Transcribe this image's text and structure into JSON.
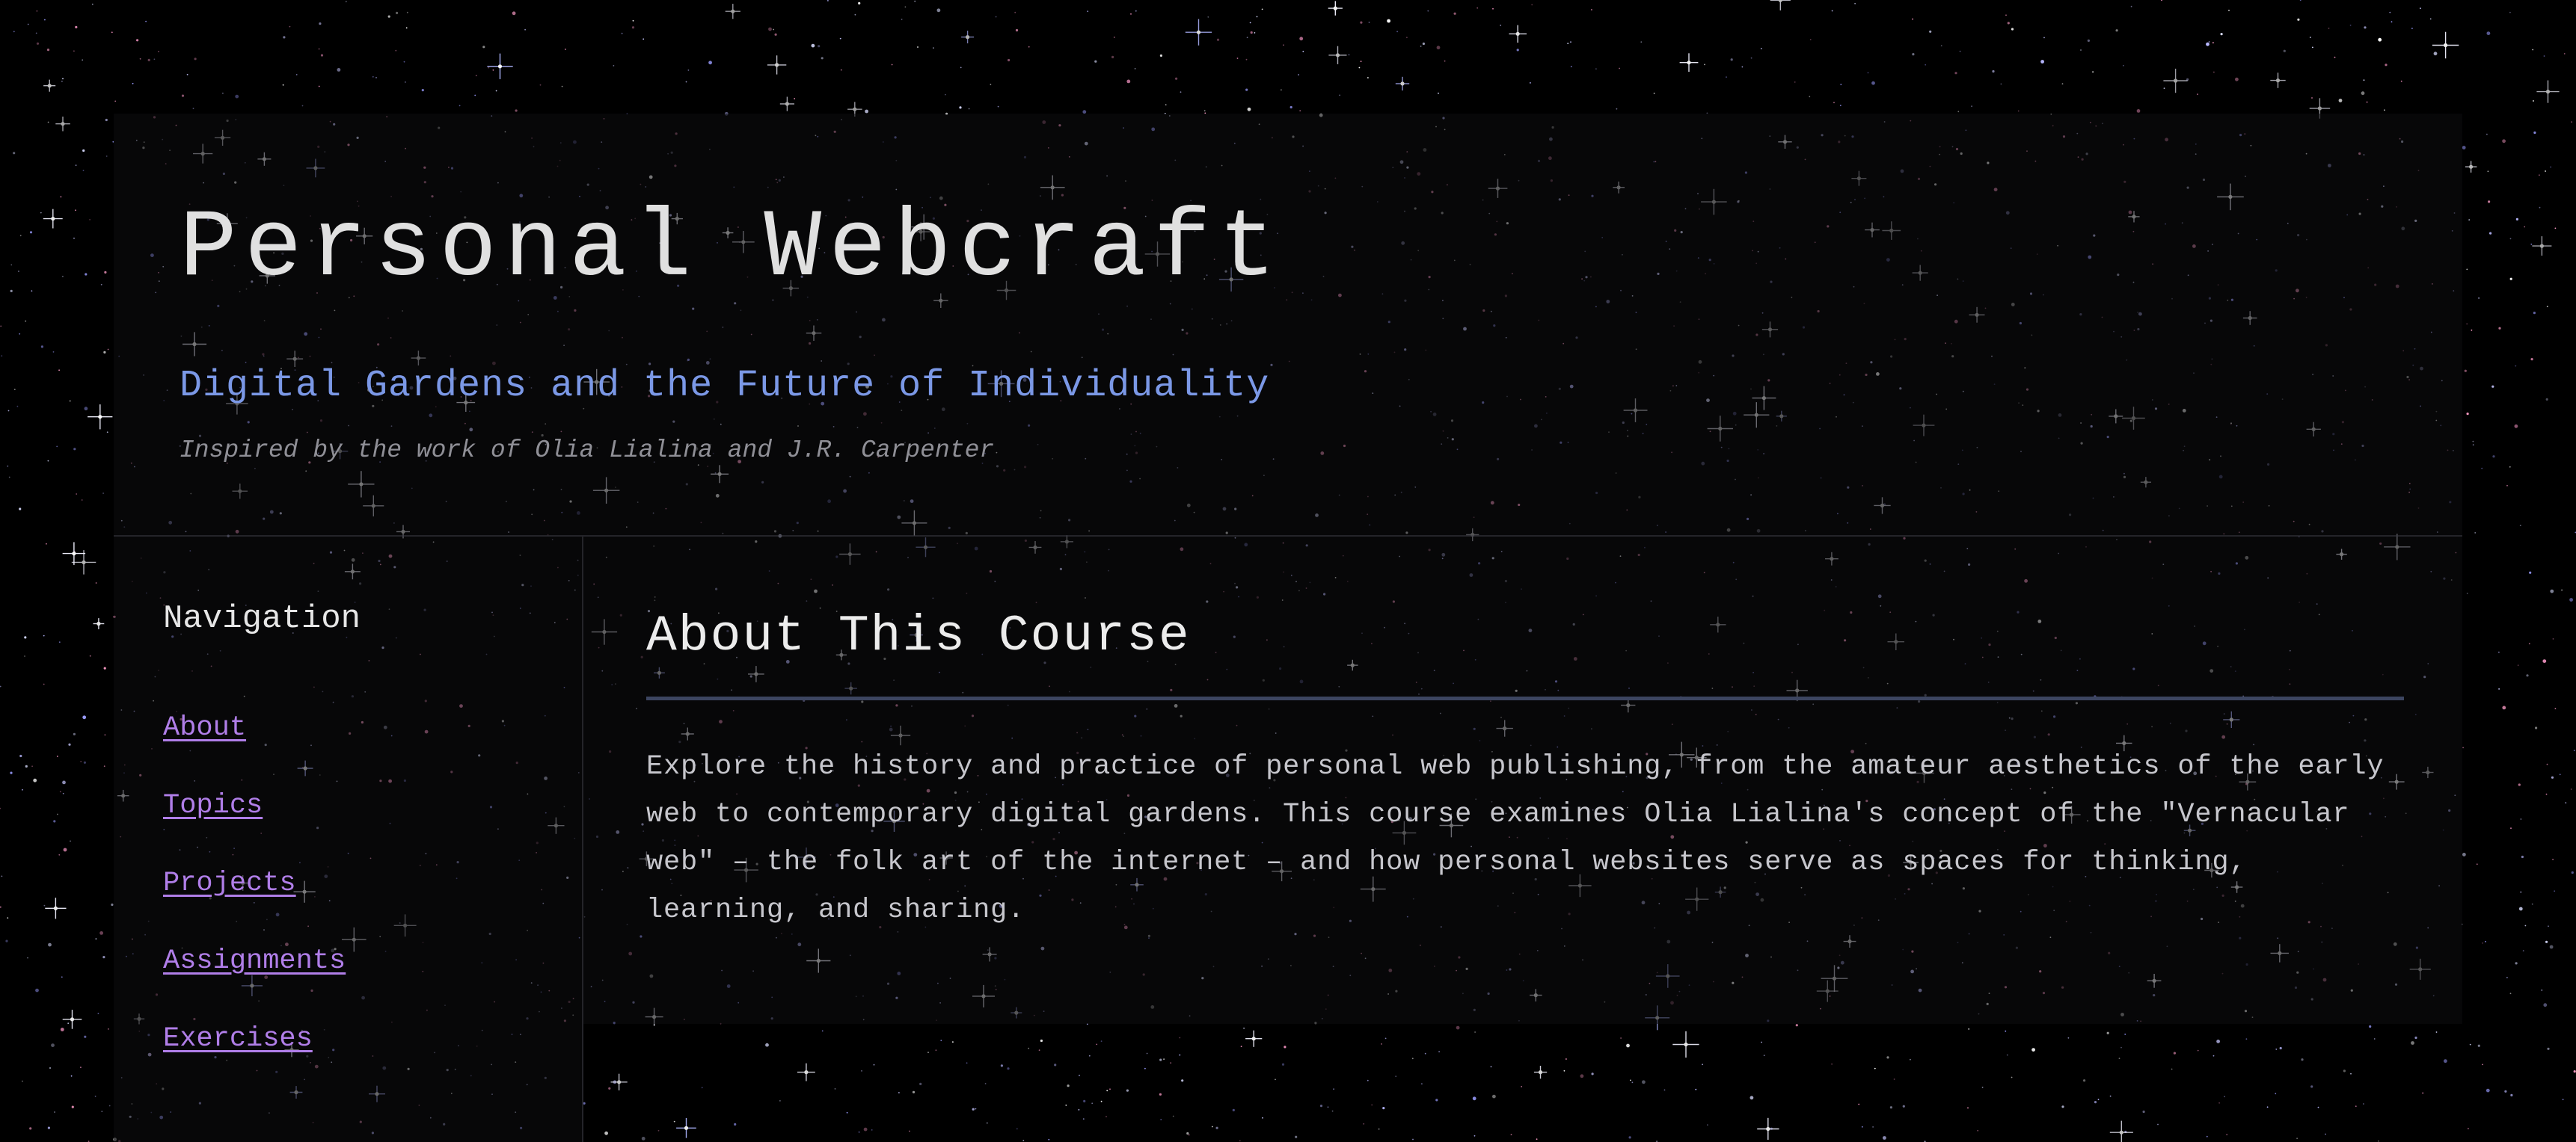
{
  "header": {
    "title": "Personal Webcraft",
    "subtitle": "Digital Gardens and the Future of Individuality",
    "credit": "Inspired by the work of Olia Lialina and J.R. Carpenter"
  },
  "sidebar": {
    "heading": "Navigation",
    "items": [
      {
        "label": "About"
      },
      {
        "label": "Topics"
      },
      {
        "label": "Projects"
      },
      {
        "label": "Assignments"
      },
      {
        "label": "Exercises"
      }
    ]
  },
  "main": {
    "section_title": "About This Course",
    "section_text": "Explore the history and practice of personal web publishing, from the amateur aesthetics of the early web to contemporary digital gardens. This course examines Olia Lialina's concept of the \"Vernacular web\" – the folk art of the internet – and how personal websites serve as spaces for thinking, learning, and sharing."
  },
  "colors": {
    "background": "#000000",
    "title": "#e0e0e0",
    "subtitle": "#7b98e6",
    "credit": "#8f8f96",
    "link": "#b07ee8",
    "body_text": "#c6c6cc",
    "rule": "#3c4560"
  }
}
